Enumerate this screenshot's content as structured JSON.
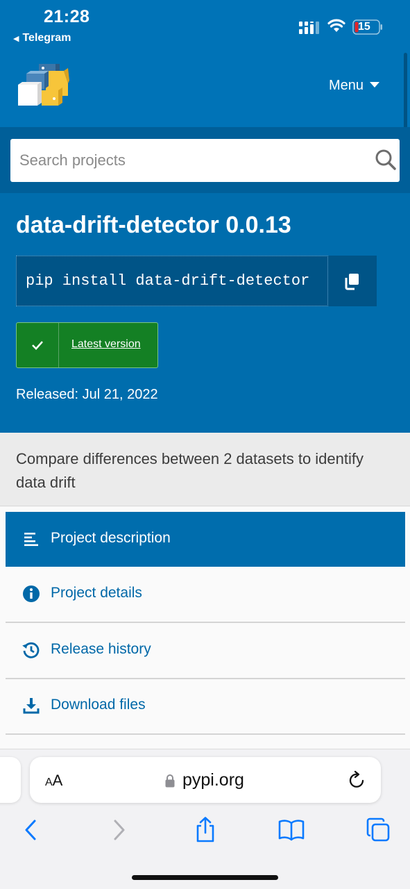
{
  "status_bar": {
    "time": "21:28",
    "back_app": "Telegram",
    "battery_level": "15",
    "battery_color": "#e0242a"
  },
  "header": {
    "menu_label": "Menu",
    "search_placeholder": "Search projects"
  },
  "package": {
    "title": "data-drift-detector 0.0.13",
    "pip_command": "pip install data-drift-detector",
    "latest_label": "Latest version",
    "released": "Released: Jul 21, 2022",
    "summary": "Compare differences between 2 datasets to identify data drift"
  },
  "nav": {
    "items": [
      {
        "label": "Project description",
        "icon": "lines-icon",
        "active": true
      },
      {
        "label": "Project details",
        "icon": "info-icon",
        "active": false
      },
      {
        "label": "Release history",
        "icon": "history-icon",
        "active": false
      },
      {
        "label": "Download files",
        "icon": "download-icon",
        "active": false
      }
    ]
  },
  "browser": {
    "aa_small": "A",
    "aa_large": "A",
    "url": "pypi.org"
  },
  "colors": {
    "pypi_blue": "#006dad",
    "pypi_dark_blue": "#005487",
    "latest_green": "#148024",
    "ios_blue": "#0a7aff"
  }
}
